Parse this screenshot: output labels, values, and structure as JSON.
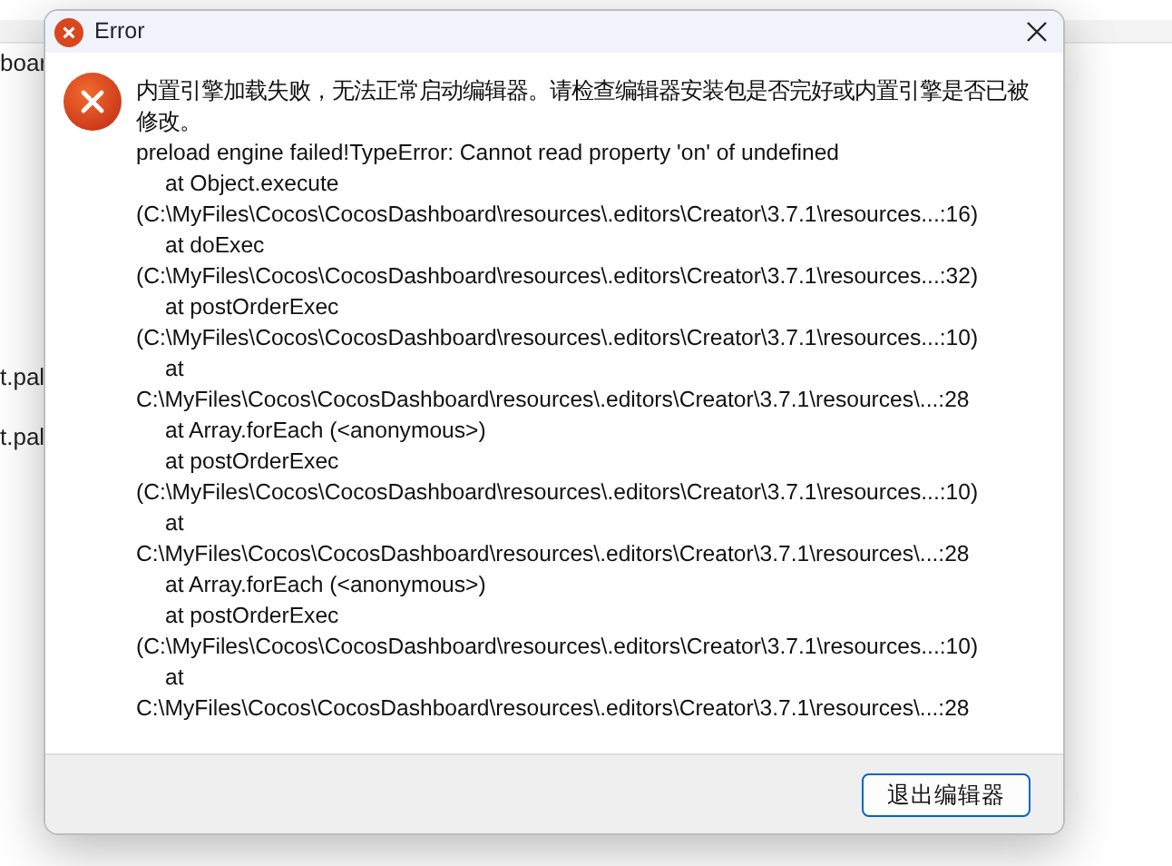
{
  "background": {
    "texts": [
      "boar",
      "t.pal",
      "t.pal"
    ]
  },
  "dialog": {
    "title": "Error",
    "message": "内置引擎加载失败，无法正常启动编辑器。请检查编辑器安装包是否完好或内置引擎是否已被修改。",
    "lines": [
      {
        "kind": "text",
        "text": "preload engine failed!TypeError: Cannot read property 'on' of undefined"
      },
      {
        "kind": "frame",
        "text": "at Object.execute"
      },
      {
        "kind": "text",
        "text": "(C:\\MyFiles\\Cocos\\CocosDashboard\\resources\\.editors\\Creator\\3.7.1\\resources...:16)"
      },
      {
        "kind": "frame",
        "text": "at doExec"
      },
      {
        "kind": "text",
        "text": "(C:\\MyFiles\\Cocos\\CocosDashboard\\resources\\.editors\\Creator\\3.7.1\\resources...:32)"
      },
      {
        "kind": "frame",
        "text": "at postOrderExec"
      },
      {
        "kind": "text",
        "text": "(C:\\MyFiles\\Cocos\\CocosDashboard\\resources\\.editors\\Creator\\3.7.1\\resources...:10)"
      },
      {
        "kind": "frame",
        "text": "at"
      },
      {
        "kind": "text",
        "text": "C:\\MyFiles\\Cocos\\CocosDashboard\\resources\\.editors\\Creator\\3.7.1\\resources\\...:28"
      },
      {
        "kind": "frame",
        "text": "at Array.forEach (<anonymous>)"
      },
      {
        "kind": "frame",
        "text": "at postOrderExec"
      },
      {
        "kind": "text",
        "text": "(C:\\MyFiles\\Cocos\\CocosDashboard\\resources\\.editors\\Creator\\3.7.1\\resources...:10)"
      },
      {
        "kind": "frame",
        "text": "at"
      },
      {
        "kind": "text",
        "text": "C:\\MyFiles\\Cocos\\CocosDashboard\\resources\\.editors\\Creator\\3.7.1\\resources\\...:28"
      },
      {
        "kind": "frame",
        "text": "at Array.forEach (<anonymous>)"
      },
      {
        "kind": "frame",
        "text": "at postOrderExec"
      },
      {
        "kind": "text",
        "text": "(C:\\MyFiles\\Cocos\\CocosDashboard\\resources\\.editors\\Creator\\3.7.1\\resources...:10)"
      },
      {
        "kind": "frame",
        "text": "at"
      },
      {
        "kind": "text",
        "text": "C:\\MyFiles\\Cocos\\CocosDashboard\\resources\\.editors\\Creator\\3.7.1\\resources\\...:28"
      }
    ],
    "button": "退出编辑器"
  }
}
